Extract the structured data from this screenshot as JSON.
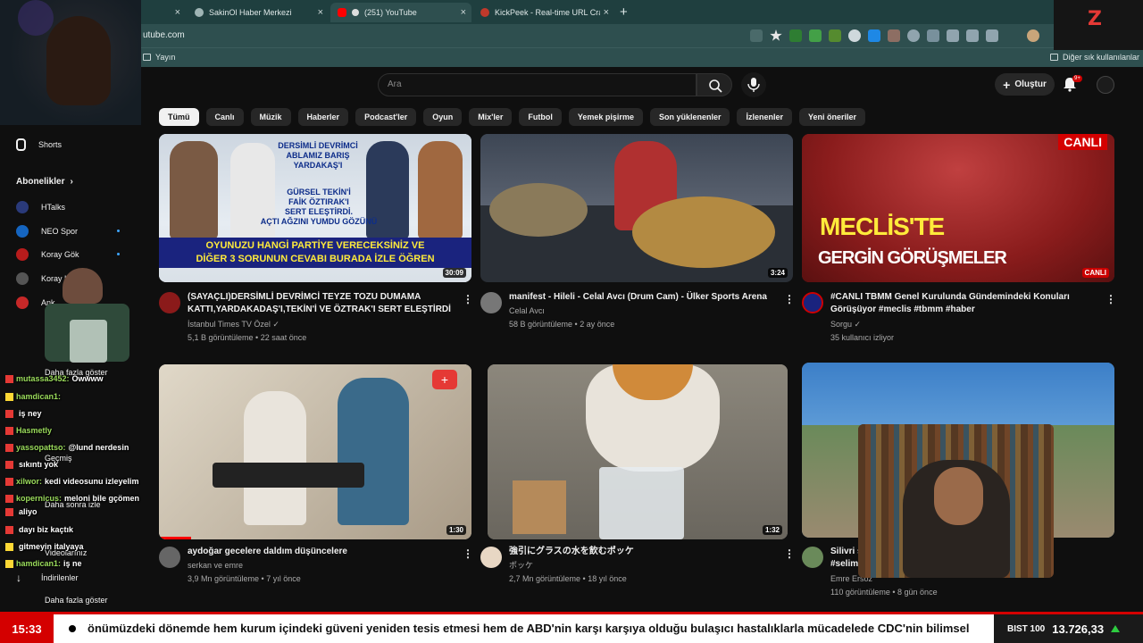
{
  "tabs": [
    {
      "label": "SakinOl Haber Merkezi",
      "active": false
    },
    {
      "label": "(251) YouTube",
      "active": true
    },
    {
      "label": "KickPeek - Real-time URL Crawler",
      "active": false
    }
  ],
  "address": {
    "url": "utube.com"
  },
  "bookmarks": {
    "left": "Yayın",
    "right": "Diğer sık kullanılanlar"
  },
  "header": {
    "search_placeholder": "Ara",
    "create_label": "Oluştur",
    "notif_badge": "9+"
  },
  "chips": [
    "Tümü",
    "Canlı",
    "Müzik",
    "Haberler",
    "Podcast'ler",
    "Oyun",
    "Mix'ler",
    "Futbol",
    "Yemek pişirme",
    "Son yüklenenler",
    "İzlenenler",
    "Yeni öneriler"
  ],
  "sidebar": {
    "shorts": "Shorts",
    "subscriptions": "Abonelikler",
    "channels": [
      "HTalks",
      "NEO Spor",
      "Koray Gök",
      "Koray Ka",
      "Ank",
      "Daha fazla göster"
    ],
    "history": "Geçmiş",
    "later": "Daha sonra izle",
    "liked": "Videolarınız",
    "downloads": "İndirilenler",
    "more": "Daha fazla göster"
  },
  "chat": [
    {
      "user": "mutassa3452:",
      "msg": "Owwww"
    },
    {
      "user": "hamdican1:",
      "msg": ""
    },
    {
      "user": "",
      "msg": "iş ney"
    },
    {
      "user": "Hasmetly",
      "msg": ""
    },
    {
      "user": "yassopattso:",
      "msg": "@lund nerdesin"
    },
    {
      "user": "",
      "msg": "sıkıntı yok"
    },
    {
      "user": "xilwor:",
      "msg": "kedi videosunu izleyelim"
    },
    {
      "user": "kopernicus:",
      "msg": "meloni bile gçömen"
    },
    {
      "user": "",
      "msg": "aliyo"
    },
    {
      "user": "",
      "msg": "dayı biz kaçtık"
    },
    {
      "user": "",
      "msg": "gitmeyin italyaya"
    },
    {
      "user": "hamdican1:",
      "msg": "iş ne"
    }
  ],
  "videos": [
    {
      "title": "(SAYAÇLI)DERSİMLİ DEVRİMCİ TEYZE TOZU DUMAMA KATTI,YARDAKADAŞ'I,TEKİN'İ VE ÖZTRAK'I SERT ELEŞTİRDİ",
      "channel": "İstanbul Times TV Özel",
      "meta": "5,1 B görüntüleme • 22 saat önce",
      "duration": "30:09",
      "verified": "✓"
    },
    {
      "title": "manifest - Hileli - Celal Avcı (Drum Cam) - Ülker Sports Arena",
      "channel": "Celal Avcı",
      "meta": "58 B görüntüleme • 2 ay önce",
      "duration": "3:24",
      "verified": ""
    },
    {
      "title": "#CANLI TBMM Genel Kurulunda Gündemindeki Konuları Görüşüyor #meclis #tbmm #haber",
      "channel": "Sorgu",
      "meta": "35 kullanıcı izliyor",
      "duration": "CANLI",
      "verified": "✓"
    },
    {
      "title": "aydoğar gecelere daldım düşüncelere",
      "channel": "serkan ve emre",
      "meta": "3,9 Mn görüntüleme • 7 yıl önce",
      "duration": "1:30",
      "verified": ""
    },
    {
      "title": "強引にグラスの水を飲むポッケ",
      "channel": "ポッケ",
      "meta": "2,7 Mn görüntüleme • 18 yıl önce",
      "duration": "1:32",
      "verified": ""
    },
    {
      "title": "Silivri s",
      "title2": "#selimp",
      "channel": "Emre Ersöz",
      "meta": "110 görüntüleme • 8 gün önce",
      "duration": "",
      "verified": ""
    }
  ],
  "thumb_text": {
    "v1_top1": "DERSİMLİ DEVRİMCİ",
    "v1_top2": "ABLAMIZ BARIŞ",
    "v1_top3": "YARDAKAŞ'I",
    "v1_mid1": "GÜRSEL TEKİN'İ",
    "v1_mid2": "FAİK ÖZTIRAK'I",
    "v1_mid3": "SERT ELEŞTİRDİ.",
    "v1_mid4": "AÇTI AĞZINI YUMDU GÖZÜNÜ",
    "v1_bot1": "OYUNUZU HANGİ PARTİYE VERECEKSİNİZ VE",
    "v1_bot2": "DİĞER 3 SORUNUN CEVABI BURADA İZLE ÖĞREN",
    "v3_live": "CANLI",
    "v3_big1": "MECLİS'TE",
    "v3_big2": "GERGİN GÖRÜŞMELER",
    "v3_badge": "CANLI"
  },
  "ticker": {
    "time": "15:33",
    "text": "önümüzdeki dönemde hem kurum içindeki güveni yeniden tesis etmesi hem de ABD'nin karşı karşıya olduğu bulaşıcı hastalıklarla mücadelede CDC'nin bilimsel",
    "index_name": "BIST 100",
    "index_value": "13.726,33"
  }
}
